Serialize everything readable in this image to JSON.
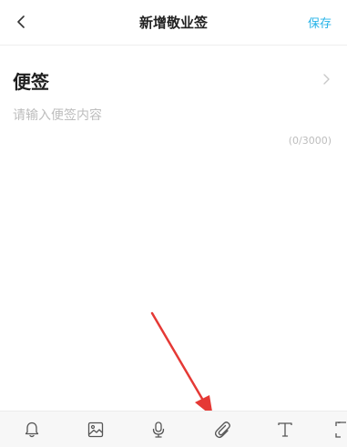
{
  "header": {
    "title": "新增敬业签",
    "save_label": "保存",
    "back_icon": "chevron-left-icon"
  },
  "category": {
    "label": "便签",
    "arrow_icon": "chevron-right-icon"
  },
  "content": {
    "placeholder": "请输入便签内容",
    "value": "",
    "char_count": "(0/3000)"
  },
  "toolbar": {
    "items": [
      {
        "icon": "bell-icon"
      },
      {
        "icon": "image-icon"
      },
      {
        "icon": "microphone-icon"
      },
      {
        "icon": "paperclip-icon"
      },
      {
        "icon": "text-format-icon"
      },
      {
        "icon": "expand-icon"
      }
    ]
  },
  "colors": {
    "accent": "#26b3e8",
    "annotation": "#e53935",
    "toolbar_bg": "#f7f7f7",
    "placeholder": "#bdbdbd"
  }
}
